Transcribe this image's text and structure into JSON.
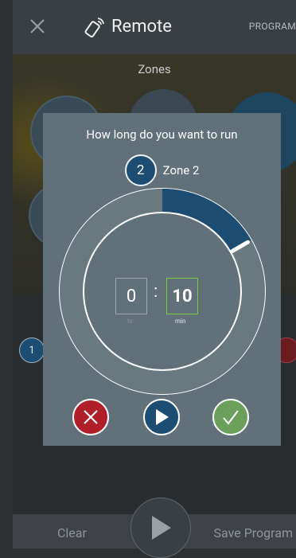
{
  "header": {
    "title": "Remote",
    "program_tab": "PROGRAM"
  },
  "zones": {
    "section_title": "Zones",
    "side_badge": "1"
  },
  "bottom": {
    "clear_label": "Clear",
    "save_label": "Save Program"
  },
  "modal": {
    "title": "How long do you want to run",
    "zone_number": "2",
    "zone_name": "Zone 2",
    "hours": "0",
    "minutes": "10",
    "colon": ":",
    "hours_unit": "hr",
    "minutes_unit": "min",
    "dial_fraction": 0.167,
    "actions": [
      "cancel-icon",
      "play-icon",
      "check-icon"
    ]
  },
  "colors": {
    "accent_blue": "#1e4d73",
    "cancel_red": "#b01e2a",
    "confirm_green": "#6aa05c",
    "minute_border": "#7ac943",
    "modal_bg": "#62707a"
  }
}
